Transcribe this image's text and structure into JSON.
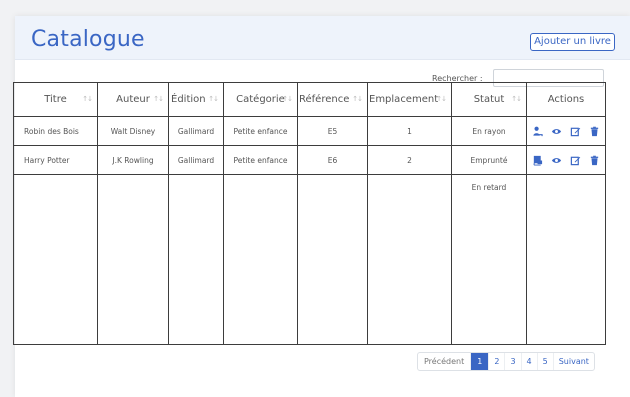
{
  "header": {
    "title": "Catalogue",
    "add_button": "Ajouter un livre"
  },
  "search": {
    "label": "Rechercher :",
    "value": "",
    "placeholder": ""
  },
  "table": {
    "columns": [
      "Titre",
      "Auteur",
      "Édition",
      "Catégorie",
      "Référence",
      "Emplacement",
      "Statut",
      "Actions"
    ],
    "sort_icon": "↑↓",
    "rows": [
      {
        "titre": "Robin des Bois",
        "auteur": "Walt Disney",
        "edition": "Gallimard",
        "categorie": "Petite enfance",
        "reference": "E5",
        "emplacement": "1",
        "statut": "En rayon",
        "primary_action_icon": "person-return-icon"
      },
      {
        "titre": "Harry Potter",
        "auteur": "J.K Rowling",
        "edition": "Gallimard",
        "categorie": "Petite enfance",
        "reference": "E6",
        "emplacement": "2",
        "statut": "Emprunté",
        "primary_action_icon": "book-icon"
      }
    ],
    "extra_status": "En retard"
  },
  "pagination": {
    "prev": "Précédent",
    "pages": [
      "1",
      "2",
      "3",
      "4",
      "5"
    ],
    "active": "1",
    "next": "Suivant"
  },
  "colors": {
    "accent": "#3a66c4",
    "header_bg": "#eef3fb"
  }
}
